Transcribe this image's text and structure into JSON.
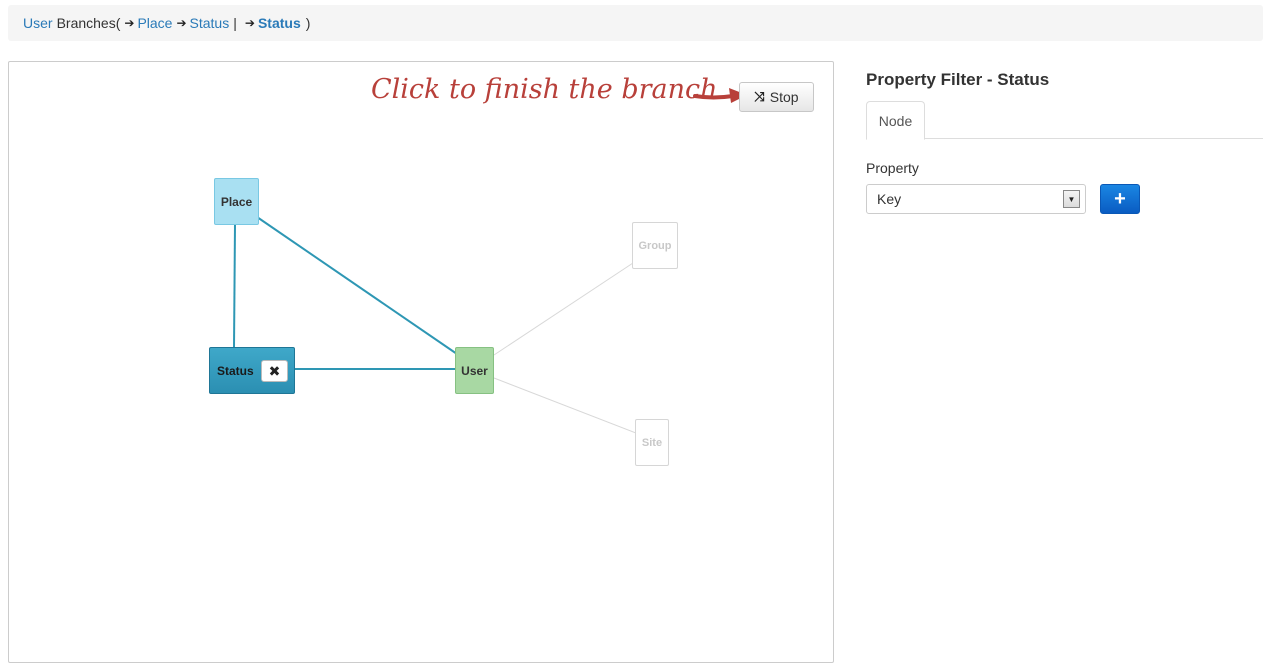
{
  "breadcrumb": {
    "root": "User",
    "branches_label": "Branches(",
    "arrow": "➔",
    "step1": "Place",
    "step2": "Status",
    "separator": "|",
    "current": "Status",
    "close": ")"
  },
  "canvas": {
    "hint": "Click to finish the branch",
    "stop_label": "Stop",
    "stop_icon": "shuffle-icon",
    "nodes": {
      "place": "Place",
      "status": "Status",
      "user": "User",
      "group": "Group",
      "site": "Site"
    },
    "remove_icon": "✖",
    "colors": {
      "active_edge": "#2e97b4",
      "inactive_edge": "#d8d8d8",
      "hint_text": "#b8403a"
    }
  },
  "panel": {
    "title": "Property Filter - Status",
    "tabs": [
      {
        "label": "Node",
        "active": true
      }
    ],
    "property_label": "Property",
    "property_value": "Key",
    "add_label": "+"
  }
}
